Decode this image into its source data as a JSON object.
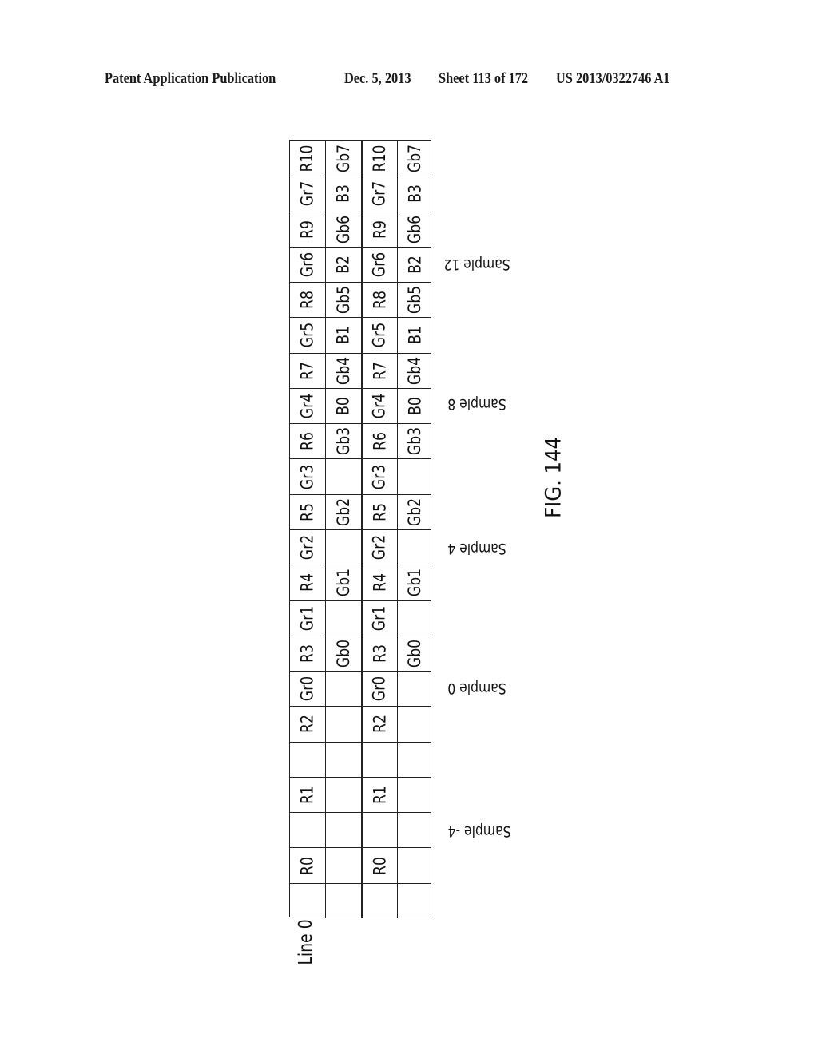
{
  "header": {
    "publication": "Patent Application Publication",
    "date": "Dec. 5, 2013",
    "sheet": "Sheet 113 of 172",
    "number": "US 2013/0322746 A1"
  },
  "figure": {
    "label": "FIG. 144",
    "line_label": "Line 0",
    "sample_labels": [
      "Sample 12",
      "Sample 8",
      "Sample 4",
      "Sample 0",
      "Sample -4"
    ],
    "orientation_note": "table rotated 90 degrees counterclockwise; rows listed from page top to bottom",
    "rows": [
      [
        "R10",
        "Gb7",
        "R10",
        "Gb7"
      ],
      [
        "Gr7",
        "B3",
        "Gr7",
        "B3"
      ],
      [
        "R9",
        "Gb6",
        "R9",
        "Gb6"
      ],
      [
        "Gr6",
        "B2",
        "Gr6",
        "B2"
      ],
      [
        "R8",
        "Gb5",
        "R8",
        "Gb5"
      ],
      [
        "Gr5",
        "B1",
        "Gr5",
        "B1"
      ],
      [
        "R7",
        "Gb4",
        "R7",
        "Gb4"
      ],
      [
        "Gr4",
        "B0",
        "Gr4",
        "B0"
      ],
      [
        "R6",
        "Gb3",
        "R6",
        "Gb3"
      ],
      [
        "Gr3",
        "",
        "Gr3",
        ""
      ],
      [
        "R5",
        "Gb2",
        "R5",
        "Gb2"
      ],
      [
        "Gr2",
        "",
        "Gr2",
        ""
      ],
      [
        "R4",
        "Gb1",
        "R4",
        "Gb1"
      ],
      [
        "Gr1",
        "",
        "Gr1",
        ""
      ],
      [
        "R3",
        "Gb0",
        "R3",
        "Gb0"
      ],
      [
        "Gr0",
        "",
        "Gr0",
        ""
      ],
      [
        "R2",
        "",
        "R2",
        ""
      ],
      [
        "",
        "",
        "",
        ""
      ],
      [
        "R1",
        "",
        "R1",
        ""
      ],
      [
        "",
        "",
        "",
        ""
      ],
      [
        "R0",
        "",
        "R0",
        ""
      ],
      [
        "",
        "",
        "",
        ""
      ]
    ]
  }
}
